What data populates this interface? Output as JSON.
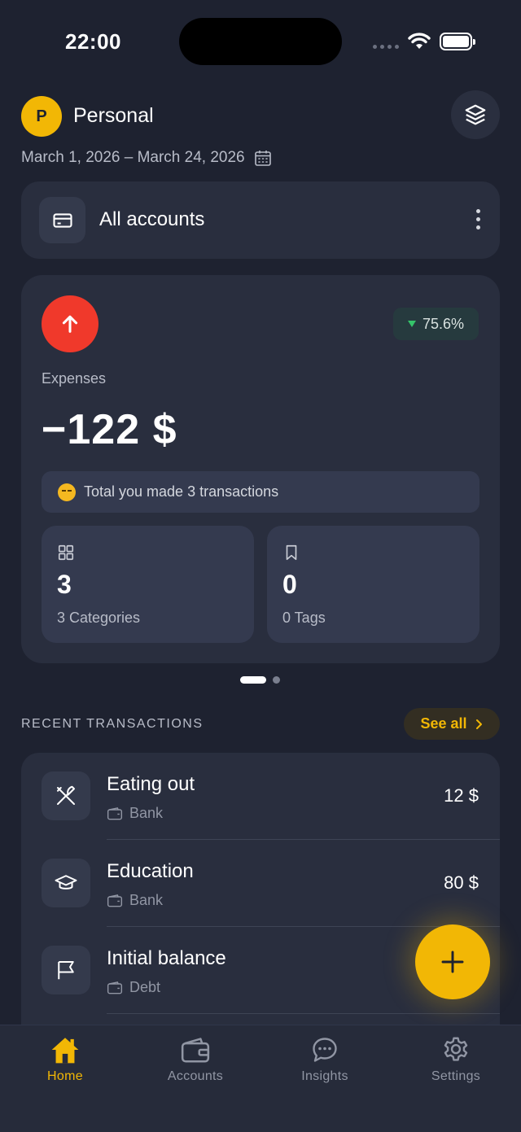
{
  "status": {
    "time": "22:00"
  },
  "header": {
    "avatar_letter": "P",
    "profile_name": "Personal",
    "date_range": "March 1, 2026 – March 24, 2026"
  },
  "accounts": {
    "label": "All accounts"
  },
  "summary": {
    "change_percent": "75.6%",
    "expense_label": "Expenses",
    "expense_amount": "−122 $",
    "total_text": "Total you made 3 transactions",
    "categories": {
      "count": "3",
      "label": "3 Categories"
    },
    "tags": {
      "count": "0",
      "label": "0 Tags"
    },
    "pager": {
      "pages": 2,
      "active": 1
    }
  },
  "recent": {
    "title": "RECENT TRANSACTIONS",
    "see_all": "See all",
    "transactions": [
      {
        "name": "Eating out",
        "account": "Bank",
        "amount": "12 $",
        "icon": "fork-knife-icon"
      },
      {
        "name": "Education",
        "account": "Bank",
        "amount": "80 $",
        "icon": "graduation-cap-icon"
      },
      {
        "name": "Initial balance",
        "account": "Debt",
        "amount": "",
        "icon": "flag-icon"
      }
    ]
  },
  "tabs": [
    {
      "label": "Home",
      "icon": "home-icon",
      "active": true
    },
    {
      "label": "Accounts",
      "icon": "wallet-icon",
      "active": false
    },
    {
      "label": "Insights",
      "icon": "chat-icon",
      "active": false
    },
    {
      "label": "Settings",
      "icon": "gear-icon",
      "active": false
    }
  ],
  "colors": {
    "accent": "#f2b705",
    "expense": "#f0392b",
    "background": "#1e2230",
    "card": "#292e3e"
  }
}
